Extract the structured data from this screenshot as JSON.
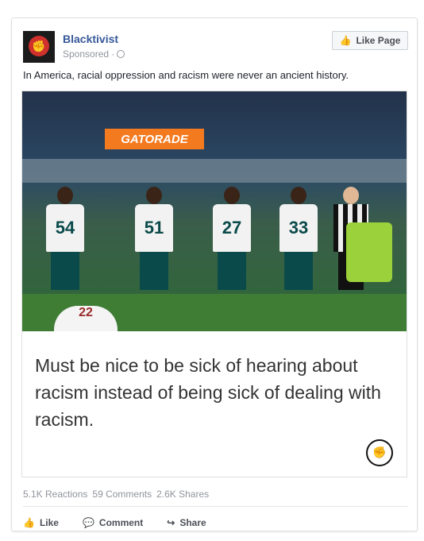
{
  "post": {
    "page_name": "Blacktivist",
    "sponsored": "Sponsored ·",
    "like_page": "Like Page",
    "message": "In America, racial oppression and racism were never an ancient history."
  },
  "media": {
    "quote": "Must be nice to be sick of hearing about racism instead of being sick of dealing with racism.",
    "banner": "GATORADE",
    "jerseys": [
      "54",
      "51",
      "27",
      "33",
      "22"
    ]
  },
  "stats": {
    "reactions": "5.1K Reactions",
    "comments": "59 Comments",
    "shares": "2.6K Shares"
  },
  "actions": {
    "like": "Like",
    "comment": "Comment",
    "share": "Share"
  },
  "icons": {
    "avatar": "fist-logo-icon",
    "like": "thumbs-up-icon",
    "comment": "speech-bubble-icon",
    "share": "share-arrow-icon"
  }
}
